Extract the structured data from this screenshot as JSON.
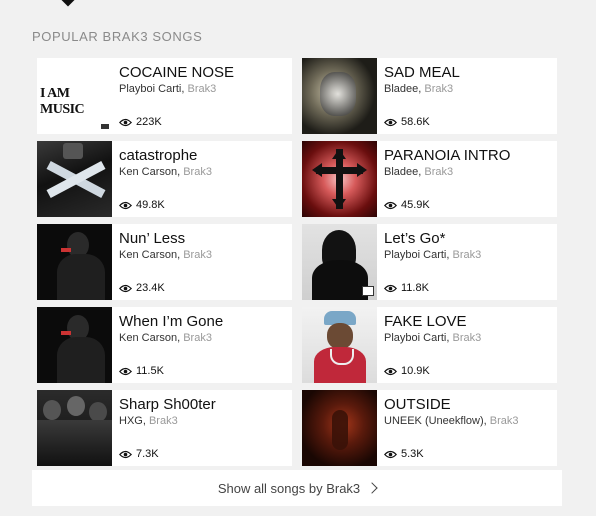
{
  "section": {
    "title": "POPULAR BRAK3 SONGS"
  },
  "songs": [
    {
      "title": "COCAINE NOSE",
      "artist": "Playboi Carti",
      "feat": "Brak3",
      "views": "223K",
      "art_text": "I AM MUSIC"
    },
    {
      "title": "SAD MEAL",
      "artist": "Bladee",
      "feat": "Brak3",
      "views": "58.6K"
    },
    {
      "title": "catastrophe",
      "artist": "Ken Carson",
      "feat": "Brak3",
      "views": "49.8K"
    },
    {
      "title": "PARANOIA INTRO",
      "artist": "Bladee",
      "feat": "Brak3",
      "views": "45.9K"
    },
    {
      "title": "Nun’ Less",
      "artist": "Ken Carson",
      "feat": "Brak3",
      "views": "23.4K"
    },
    {
      "title": "Let’s Go*",
      "artist": "Playboi Carti",
      "feat": "Brak3",
      "views": "11.8K"
    },
    {
      "title": "When I’m Gone",
      "artist": "Ken Carson",
      "feat": "Brak3",
      "views": "11.5K"
    },
    {
      "title": "FAKE LOVE",
      "artist": "Playboi Carti",
      "feat": "Brak3",
      "views": "10.9K"
    },
    {
      "title": "Sharp Sh00ter",
      "artist": "HXG",
      "feat": "Brak3",
      "views": "7.3K"
    },
    {
      "title": "OUTSIDE",
      "artist": "UNEEK (Uneekflow)",
      "feat": "Brak3",
      "views": "5.3K"
    }
  ],
  "show_all": {
    "label": "Show all songs by Brak3"
  }
}
